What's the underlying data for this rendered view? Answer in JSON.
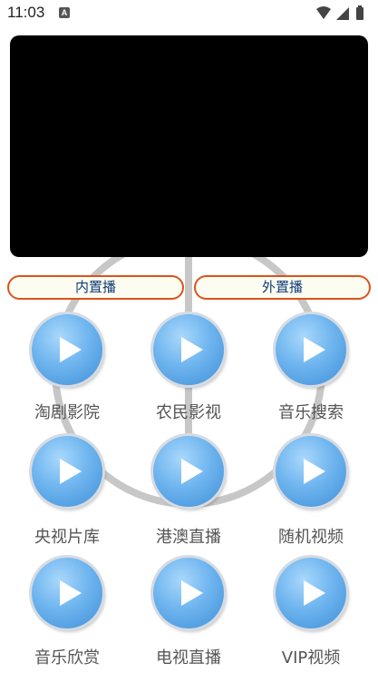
{
  "status": {
    "time": "11:03",
    "notification_glyph": "A"
  },
  "player": {
    "inner_label": "内置播",
    "outer_label": "外置播"
  },
  "tiles": [
    {
      "label": "淘剧影院"
    },
    {
      "label": "农民影视"
    },
    {
      "label": "音乐搜索"
    },
    {
      "label": "央视片库"
    },
    {
      "label": "港澳直播"
    },
    {
      "label": "随机视频"
    },
    {
      "label": "音乐欣赏"
    },
    {
      "label": "电视直播"
    },
    {
      "label": "VIP视频"
    }
  ],
  "colors": {
    "accent_border": "#d9541e",
    "button_text": "#0f3d7a",
    "play_button": "#6fb5ef",
    "ring": "#c7c7c7"
  }
}
